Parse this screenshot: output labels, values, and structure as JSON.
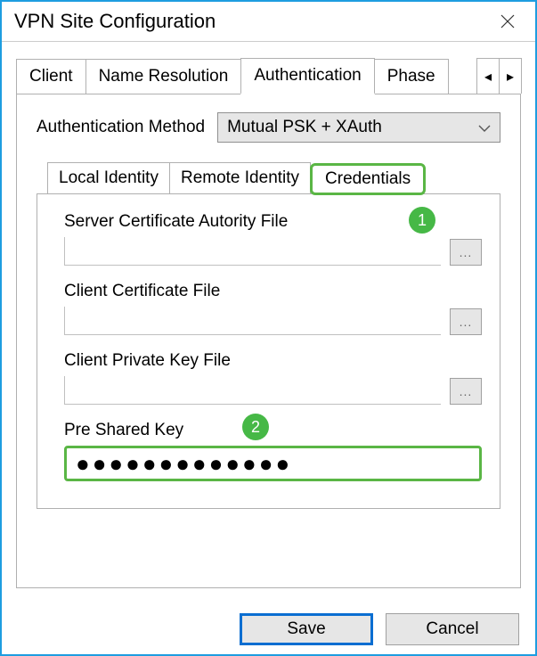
{
  "window": {
    "title": "VPN Site Configuration"
  },
  "main_tabs": {
    "items": [
      {
        "label": "Client"
      },
      {
        "label": "Name Resolution"
      },
      {
        "label": "Authentication"
      },
      {
        "label": "Phase"
      }
    ],
    "active_index": 2
  },
  "auth": {
    "method_label": "Authentication Method",
    "method_value": "Mutual PSK + XAuth"
  },
  "sub_tabs": {
    "items": [
      {
        "label": "Local Identity"
      },
      {
        "label": "Remote Identity"
      },
      {
        "label": "Credentials"
      }
    ],
    "active_index": 2
  },
  "credentials": {
    "server_ca_label": "Server Certificate Autority File",
    "server_ca_value": "",
    "client_cert_label": "Client Certificate File",
    "client_cert_value": "",
    "client_key_label": "Client Private Key File",
    "client_key_value": "",
    "psk_label": "Pre Shared Key",
    "psk_value": "●●●●●●●●●●●●●",
    "browse_label": "..."
  },
  "annotations": {
    "badge1": "1",
    "badge2": "2"
  },
  "buttons": {
    "save": "Save",
    "cancel": "Cancel"
  }
}
